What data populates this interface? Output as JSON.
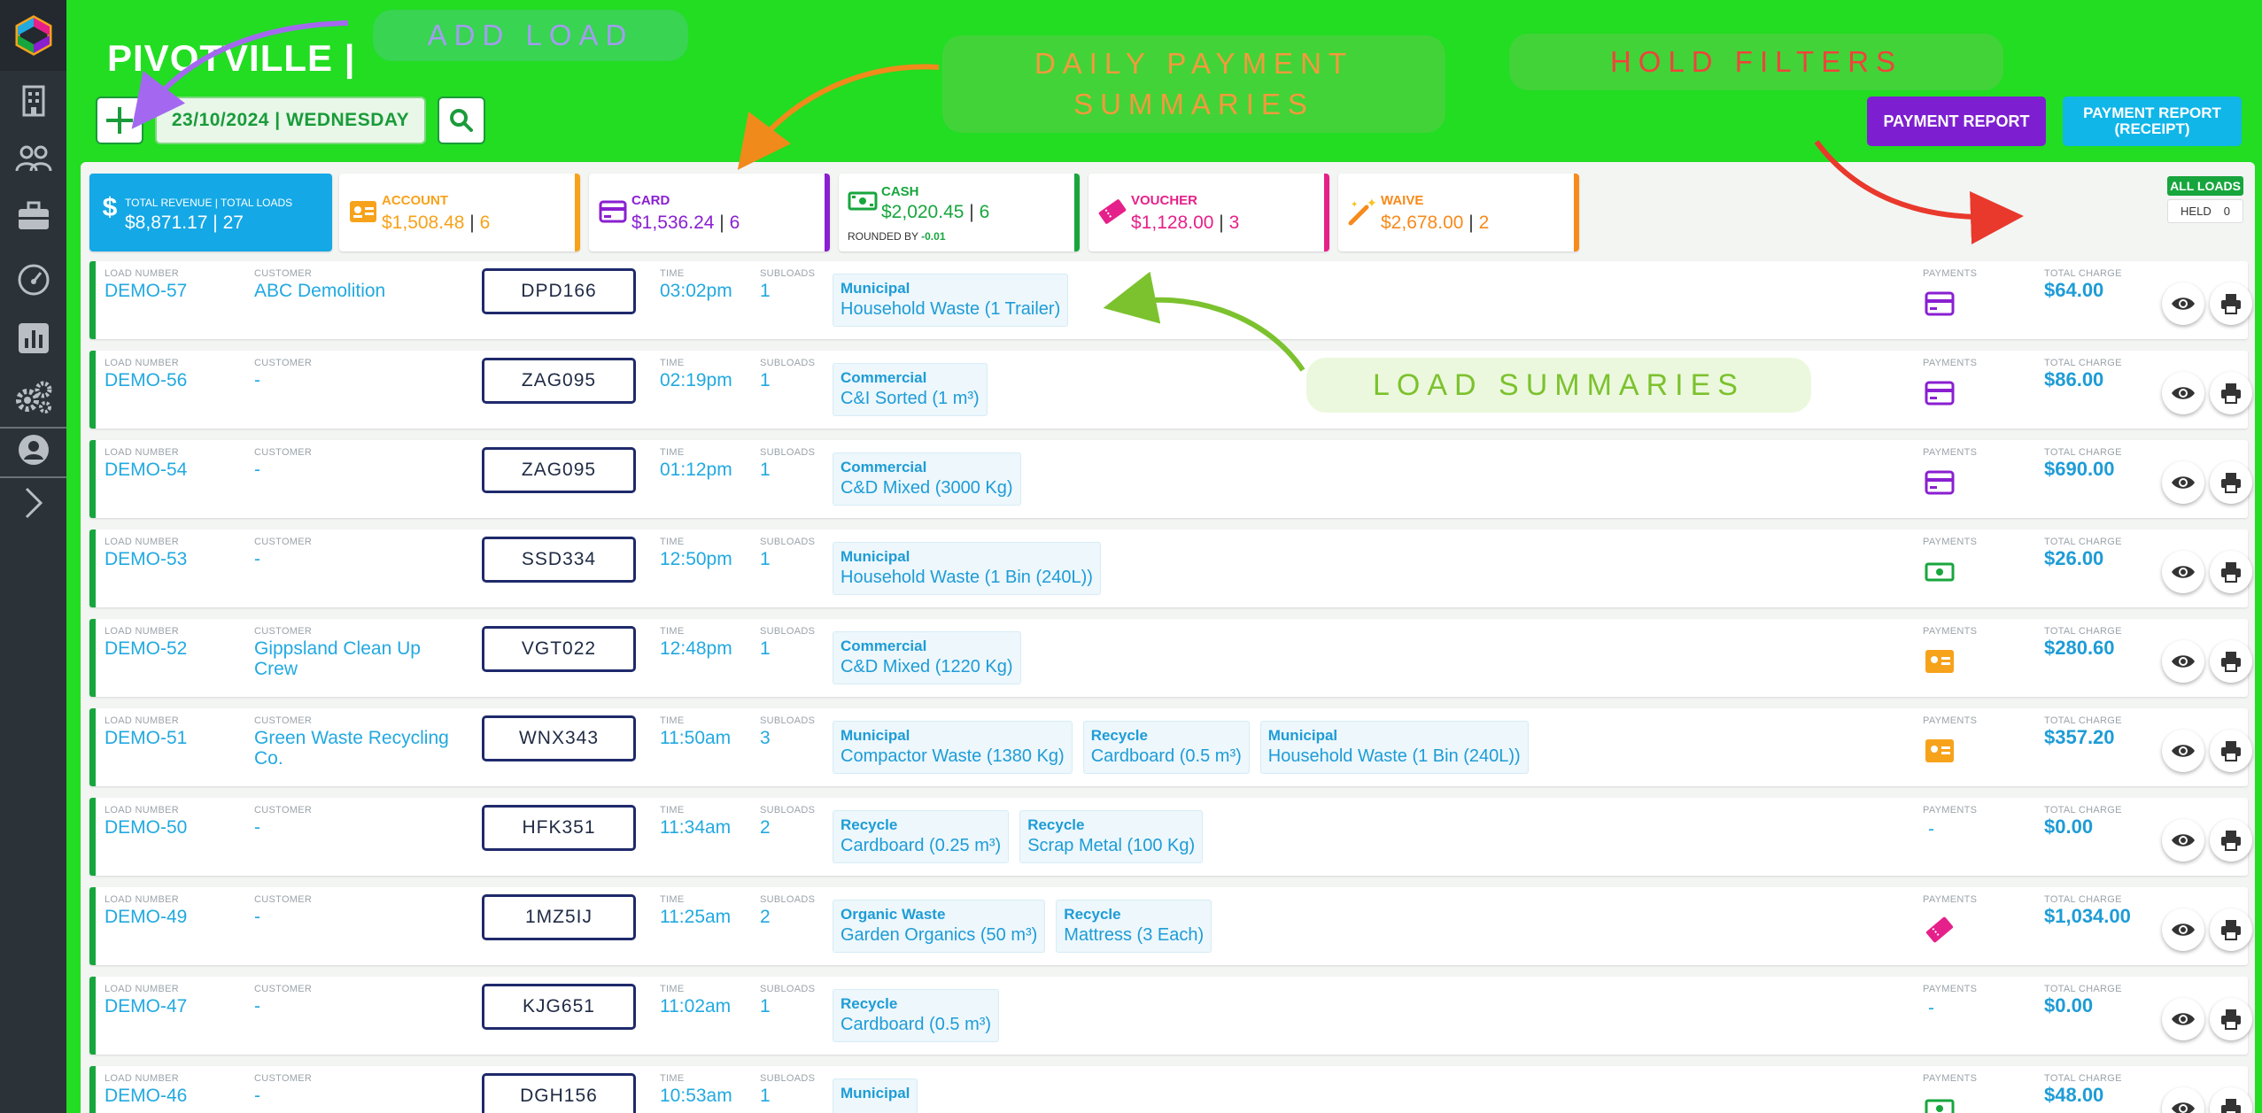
{
  "app": {
    "title": "PIVOTVILLE |",
    "date": "23/10/2024 | WEDNESDAY"
  },
  "buttons": {
    "payment_report": "PAYMENT REPORT",
    "payment_receipt_line1": "PAYMENT REPORT",
    "payment_receipt_line2": "(RECEIPT)"
  },
  "filters": {
    "all_loads": "ALL LOADS",
    "held_label": "HELD",
    "held_count": "0"
  },
  "summary": {
    "total": {
      "label": "TOTAL REVENUE | TOTAL LOADS",
      "amount": "$8,871.17",
      "count": "27"
    },
    "account": {
      "label": "ACCOUNT",
      "amount": "$1,508.48",
      "count": "6"
    },
    "card": {
      "label": "CARD",
      "amount": "$1,536.24",
      "count": "6"
    },
    "cash": {
      "label": "CASH",
      "amount": "$2,020.45",
      "count": "6",
      "rounded_label": "ROUNDED BY",
      "rounded_value": "-0.01"
    },
    "voucher": {
      "label": "VOUCHER",
      "amount": "$1,128.00",
      "count": "3"
    },
    "waive": {
      "label": "WAIVE",
      "amount": "$2,678.00",
      "count": "2"
    }
  },
  "columns": {
    "load_number": "LOAD NUMBER",
    "customer": "CUSTOMER",
    "time": "TIME",
    "subloads": "SUBLOADS",
    "payments": "PAYMENTS",
    "total_charge": "TOTAL CHARGE"
  },
  "loads": [
    {
      "load_number": "DEMO-57",
      "customer": "ABC Demolition",
      "plate": "DPD166",
      "time": "03:02pm",
      "subloads": "1",
      "payment": "card",
      "payment_text": "",
      "charge": "$64.00",
      "items": [
        {
          "category": "Municipal",
          "detail": "Household Waste (1 Trailer)"
        }
      ]
    },
    {
      "load_number": "DEMO-56",
      "customer": "-",
      "plate": "ZAG095",
      "time": "02:19pm",
      "subloads": "1",
      "payment": "card",
      "payment_text": "",
      "charge": "$86.00",
      "items": [
        {
          "category": "Commercial",
          "detail": "C&I Sorted (1 m³)"
        }
      ]
    },
    {
      "load_number": "DEMO-54",
      "customer": "-",
      "plate": "ZAG095",
      "time": "01:12pm",
      "subloads": "1",
      "payment": "card",
      "payment_text": "",
      "charge": "$690.00",
      "items": [
        {
          "category": "Commercial",
          "detail": "C&D Mixed (3000 Kg)"
        }
      ]
    },
    {
      "load_number": "DEMO-53",
      "customer": "-",
      "plate": "SSD334",
      "time": "12:50pm",
      "subloads": "1",
      "payment": "cash",
      "payment_text": "",
      "charge": "$26.00",
      "items": [
        {
          "category": "Municipal",
          "detail": "Household Waste (1 Bin (240L))"
        }
      ]
    },
    {
      "load_number": "DEMO-52",
      "customer": "Gippsland Clean Up Crew",
      "plate": "VGT022",
      "time": "12:48pm",
      "subloads": "1",
      "payment": "account",
      "payment_text": "",
      "charge": "$280.60",
      "items": [
        {
          "category": "Commercial",
          "detail": "C&D Mixed (1220 Kg)"
        }
      ]
    },
    {
      "load_number": "DEMO-51",
      "customer": "Green Waste Recycling Co.",
      "plate": "WNX343",
      "time": "11:50am",
      "subloads": "3",
      "payment": "account",
      "payment_text": "",
      "charge": "$357.20",
      "items": [
        {
          "category": "Municipal",
          "detail": "Compactor Waste (1380 Kg)"
        },
        {
          "category": "Recycle",
          "detail": "Cardboard (0.5 m³)"
        },
        {
          "category": "Municipal",
          "detail": "Household Waste (1 Bin (240L))"
        }
      ]
    },
    {
      "load_number": "DEMO-50",
      "customer": "-",
      "plate": "HFK351",
      "time": "11:34am",
      "subloads": "2",
      "payment": "none",
      "payment_text": "-",
      "charge": "$0.00",
      "items": [
        {
          "category": "Recycle",
          "detail": "Cardboard (0.25 m³)"
        },
        {
          "category": "Recycle",
          "detail": "Scrap Metal (100 Kg)"
        }
      ]
    },
    {
      "load_number": "DEMO-49",
      "customer": "-",
      "plate": "1MZ5IJ",
      "time": "11:25am",
      "subloads": "2",
      "payment": "voucher",
      "payment_text": "",
      "charge": "$1,034.00",
      "items": [
        {
          "category": "Organic Waste",
          "detail": "Garden Organics (50 m³)"
        },
        {
          "category": "Recycle",
          "detail": "Mattress (3 Each)"
        }
      ]
    },
    {
      "load_number": "DEMO-47",
      "customer": "-",
      "plate": "KJG651",
      "time": "11:02am",
      "subloads": "1",
      "payment": "none",
      "payment_text": "-",
      "charge": "$0.00",
      "items": [
        {
          "category": "Recycle",
          "detail": "Cardboard (0.5 m³)"
        }
      ]
    },
    {
      "load_number": "DEMO-46",
      "customer": "-",
      "plate": "DGH156",
      "time": "10:53am",
      "subloads": "1",
      "payment": "cash",
      "payment_text": "",
      "charge": "$48.00",
      "items": [
        {
          "category": "Municipal",
          "detail": ""
        }
      ]
    }
  ],
  "annotations": {
    "add_load": "ADD LOAD",
    "daily_payment_line1": "DAILY PAYMENT",
    "daily_payment_line2": "SUMMARIES",
    "hold_filters": "HOLD FILTERS",
    "load_summaries": "LOAD SUMMARIES"
  },
  "colors": {
    "background": "#22dd22",
    "sidebar": "#2b3238",
    "accent_blue": "#22a9e0",
    "account": "#f7a21b",
    "card": "#8a1fd1",
    "cash": "#17a63d",
    "voucher": "#e6208a",
    "waive": "#f78a1b"
  }
}
